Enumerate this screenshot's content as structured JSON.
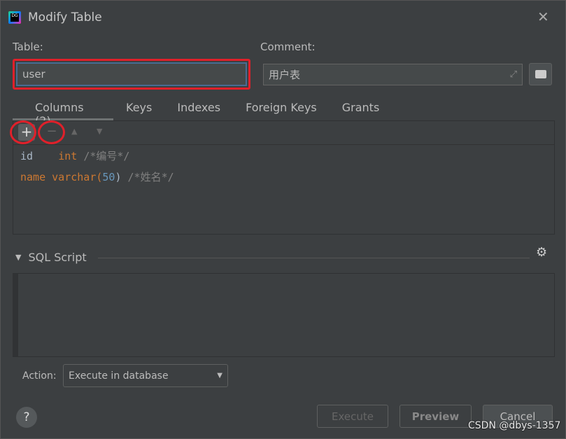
{
  "window": {
    "title": "Modify Table",
    "app_icon": "datagrip-logo",
    "close_icon": "close-icon"
  },
  "table": {
    "label": "Table:",
    "value": "user"
  },
  "comment": {
    "label": "Comment:",
    "value": "用户表"
  },
  "tabs": [
    {
      "label": "Columns (2)",
      "active": true
    },
    {
      "label": "Keys"
    },
    {
      "label": "Indexes"
    },
    {
      "label": "Foreign Keys"
    },
    {
      "label": "Grants"
    }
  ],
  "toolbar": {
    "add": "+",
    "remove": "−",
    "up": "▲",
    "down": "▼"
  },
  "columns": [
    {
      "name": "id",
      "type": "int",
      "pad": "  ",
      "comment": "/*编号*/"
    },
    {
      "name": "name",
      "type": "varchar(",
      "len": "50",
      "close": ")",
      "comment": "/*姓名*/"
    }
  ],
  "sql_script": {
    "label": "SQL Script"
  },
  "action": {
    "label": "Action:",
    "value": "Execute in database"
  },
  "buttons": {
    "execute": "Execute",
    "preview": "Preview",
    "cancel": "Cancel",
    "help": "?"
  },
  "watermark": "CSDN @dbys-1357",
  "colors": {
    "highlight": "#e0202a",
    "keyword": "#cc7832",
    "number": "#6897bb",
    "comment": "#808080"
  }
}
